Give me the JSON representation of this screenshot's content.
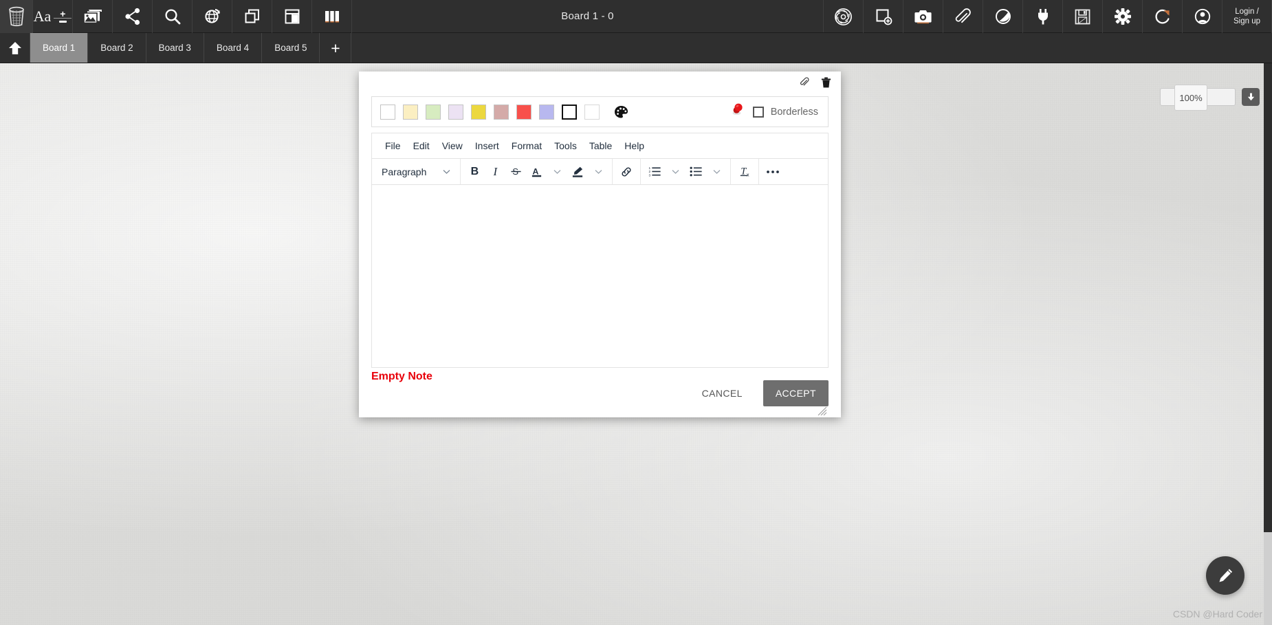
{
  "topbar": {
    "title": "Board 1 - 0",
    "left_tools": [
      {
        "name": "trash-icon",
        "label": "Trash"
      },
      {
        "name": "font-size-tool",
        "label": "Aa"
      },
      {
        "name": "image-icon",
        "label": "Images"
      },
      {
        "name": "share-icon",
        "label": "Share"
      },
      {
        "name": "search-icon",
        "label": "Search"
      },
      {
        "name": "globe-refresh-icon",
        "label": "Web"
      },
      {
        "name": "copy-icon",
        "label": "Duplicate"
      },
      {
        "name": "layout-icon",
        "label": "Layout"
      },
      {
        "name": "columns-icon",
        "label": "Columns"
      }
    ],
    "right_tools": [
      {
        "name": "openai-icon",
        "label": "AI"
      },
      {
        "name": "new-note-icon",
        "label": "New note"
      },
      {
        "name": "camera-icon",
        "label": "Camera"
      },
      {
        "name": "attachment-icon",
        "label": "Attach"
      },
      {
        "name": "drawing-icon",
        "label": "Draw"
      },
      {
        "name": "plug-icon",
        "label": "Plugins"
      },
      {
        "name": "save-icon",
        "label": "Save"
      },
      {
        "name": "gear-icon",
        "label": "Settings"
      },
      {
        "name": "refresh-icon",
        "label": "Reload"
      },
      {
        "name": "account-icon",
        "label": "Account"
      }
    ],
    "login_line1": "Login /",
    "login_line2": "Sign up"
  },
  "tabs": {
    "home_label": "Home",
    "items": [
      {
        "label": "Board 1",
        "active": true
      },
      {
        "label": "Board 2",
        "active": false
      },
      {
        "label": "Board 3",
        "active": false
      },
      {
        "label": "Board 4",
        "active": false
      },
      {
        "label": "Board 5",
        "active": false
      }
    ],
    "add_label": "+"
  },
  "zoom_control": {
    "value": "100%",
    "download_icon": "download-icon"
  },
  "note_dialog": {
    "top_icons": [
      {
        "name": "attachment-icon",
        "label": "Attach file"
      },
      {
        "name": "delete-icon",
        "label": "Delete note"
      }
    ],
    "swatches": [
      {
        "name": "swatch-white",
        "color": "#ffffff"
      },
      {
        "name": "swatch-light-yellow",
        "color": "#fbefc2"
      },
      {
        "name": "swatch-light-green",
        "color": "#d7ecc0"
      },
      {
        "name": "swatch-light-purple",
        "color": "#ece2f3"
      },
      {
        "name": "swatch-yellow",
        "color": "#ecd83f"
      },
      {
        "name": "swatch-dusty-rose",
        "color": "#d4aaa8"
      },
      {
        "name": "swatch-red",
        "color": "#f8504b"
      },
      {
        "name": "swatch-periwinkle",
        "color": "#b8b8ef"
      },
      {
        "name": "swatch-outline-black",
        "color": "#ffffff"
      },
      {
        "name": "swatch-outline-light",
        "color": "#ffffff"
      }
    ],
    "palette_icon": "color-palette-icon",
    "pin_icon": "red-pushpin-icon",
    "borderless_label": "Borderless",
    "borderless_checked": false,
    "menu": [
      "File",
      "Edit",
      "View",
      "Insert",
      "Format",
      "Tools",
      "Table",
      "Help"
    ],
    "format_toolbar": {
      "block_format": "Paragraph",
      "buttons": [
        {
          "name": "bold-button",
          "glyph": "B"
        },
        {
          "name": "italic-button",
          "glyph": "I"
        },
        {
          "name": "strikethrough-button",
          "glyph": "S"
        },
        {
          "name": "text-color-button",
          "glyph": "A"
        },
        {
          "name": "highlight-color-button",
          "glyph": "pen"
        },
        {
          "name": "link-button",
          "glyph": "link"
        },
        {
          "name": "numbered-list-button",
          "glyph": "ol"
        },
        {
          "name": "bulleted-list-button",
          "glyph": "ul"
        },
        {
          "name": "clear-formatting-button",
          "glyph": "Tx"
        },
        {
          "name": "more-options-button",
          "glyph": "..."
        }
      ]
    },
    "editor_content": "",
    "validation_message": "Empty Note",
    "cancel_label": "CANCEL",
    "accept_label": "ACCEPT"
  },
  "fab": {
    "icon": "pencil-icon",
    "label": "Draw"
  },
  "watermark": {
    "text": "CSDN @Hard Coder"
  },
  "colors": {
    "toolbar_bg": "#2f2f2f",
    "tab_active_bg": "#8e8e8e",
    "accent_red": "#e8000a",
    "accept_button_bg": "#6e6e6e",
    "canvas_bg": "#dedede"
  }
}
